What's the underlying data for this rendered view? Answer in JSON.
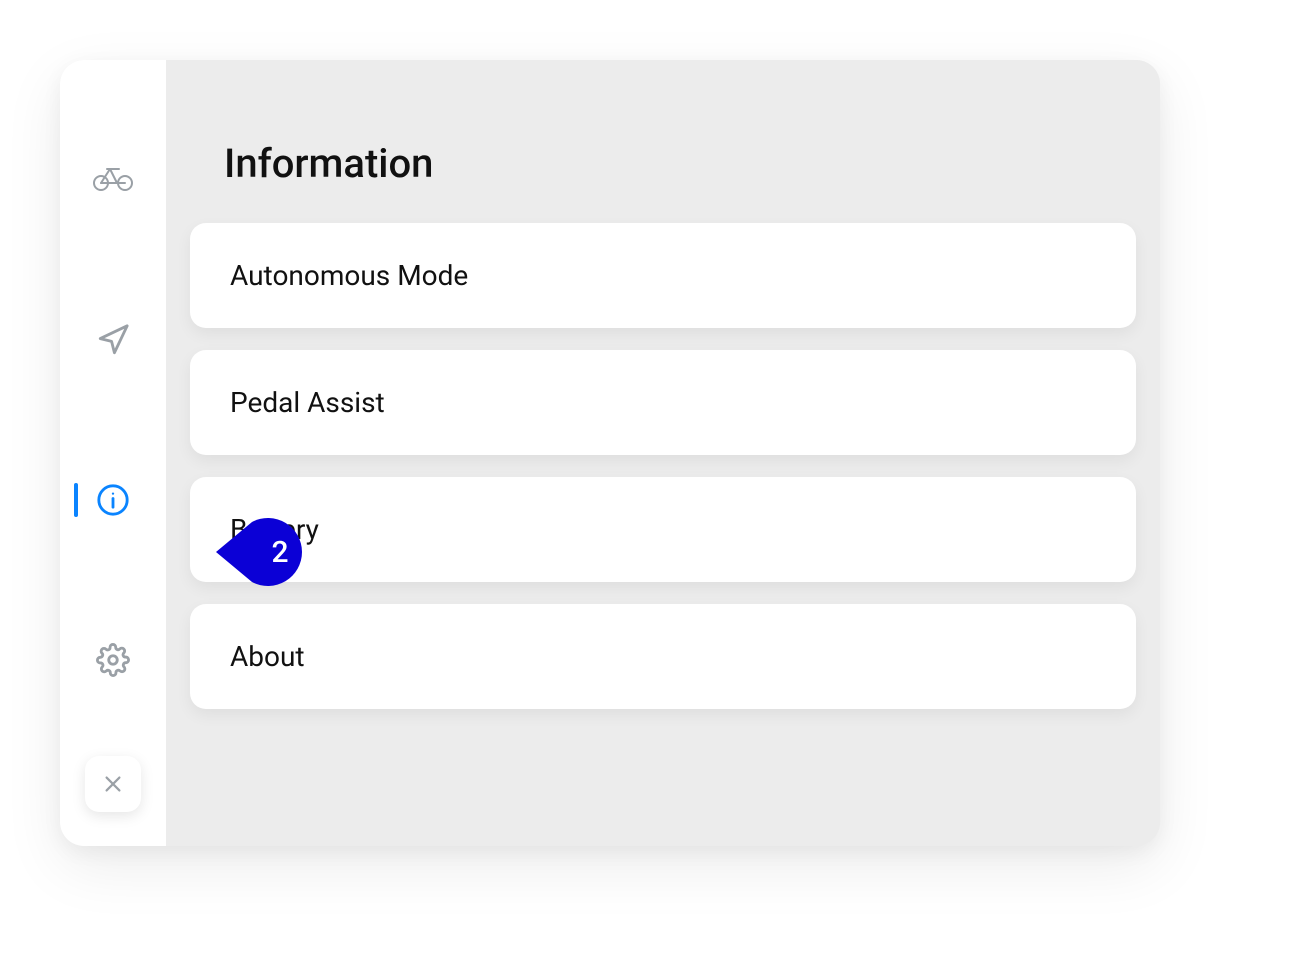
{
  "colors": {
    "accent": "#0a84ff",
    "marker": "#0b00d6",
    "icon_inactive": "#9aa0a6",
    "card_bg": "#ffffff",
    "content_bg": "#ececec"
  },
  "sidebar": {
    "items": {
      "bike": {
        "name": "bike-icon"
      },
      "nav": {
        "name": "navigation-icon"
      },
      "info": {
        "name": "info-icon",
        "active": true
      },
      "gear": {
        "name": "settings-icon"
      }
    },
    "close": {
      "name": "close-icon"
    }
  },
  "page": {
    "title": "Information"
  },
  "info_items": [
    {
      "label": "Autonomous Mode"
    },
    {
      "label": "Pedal Assist"
    },
    {
      "label": "Battery"
    },
    {
      "label": "About"
    }
  ],
  "tour": {
    "step": "2"
  }
}
